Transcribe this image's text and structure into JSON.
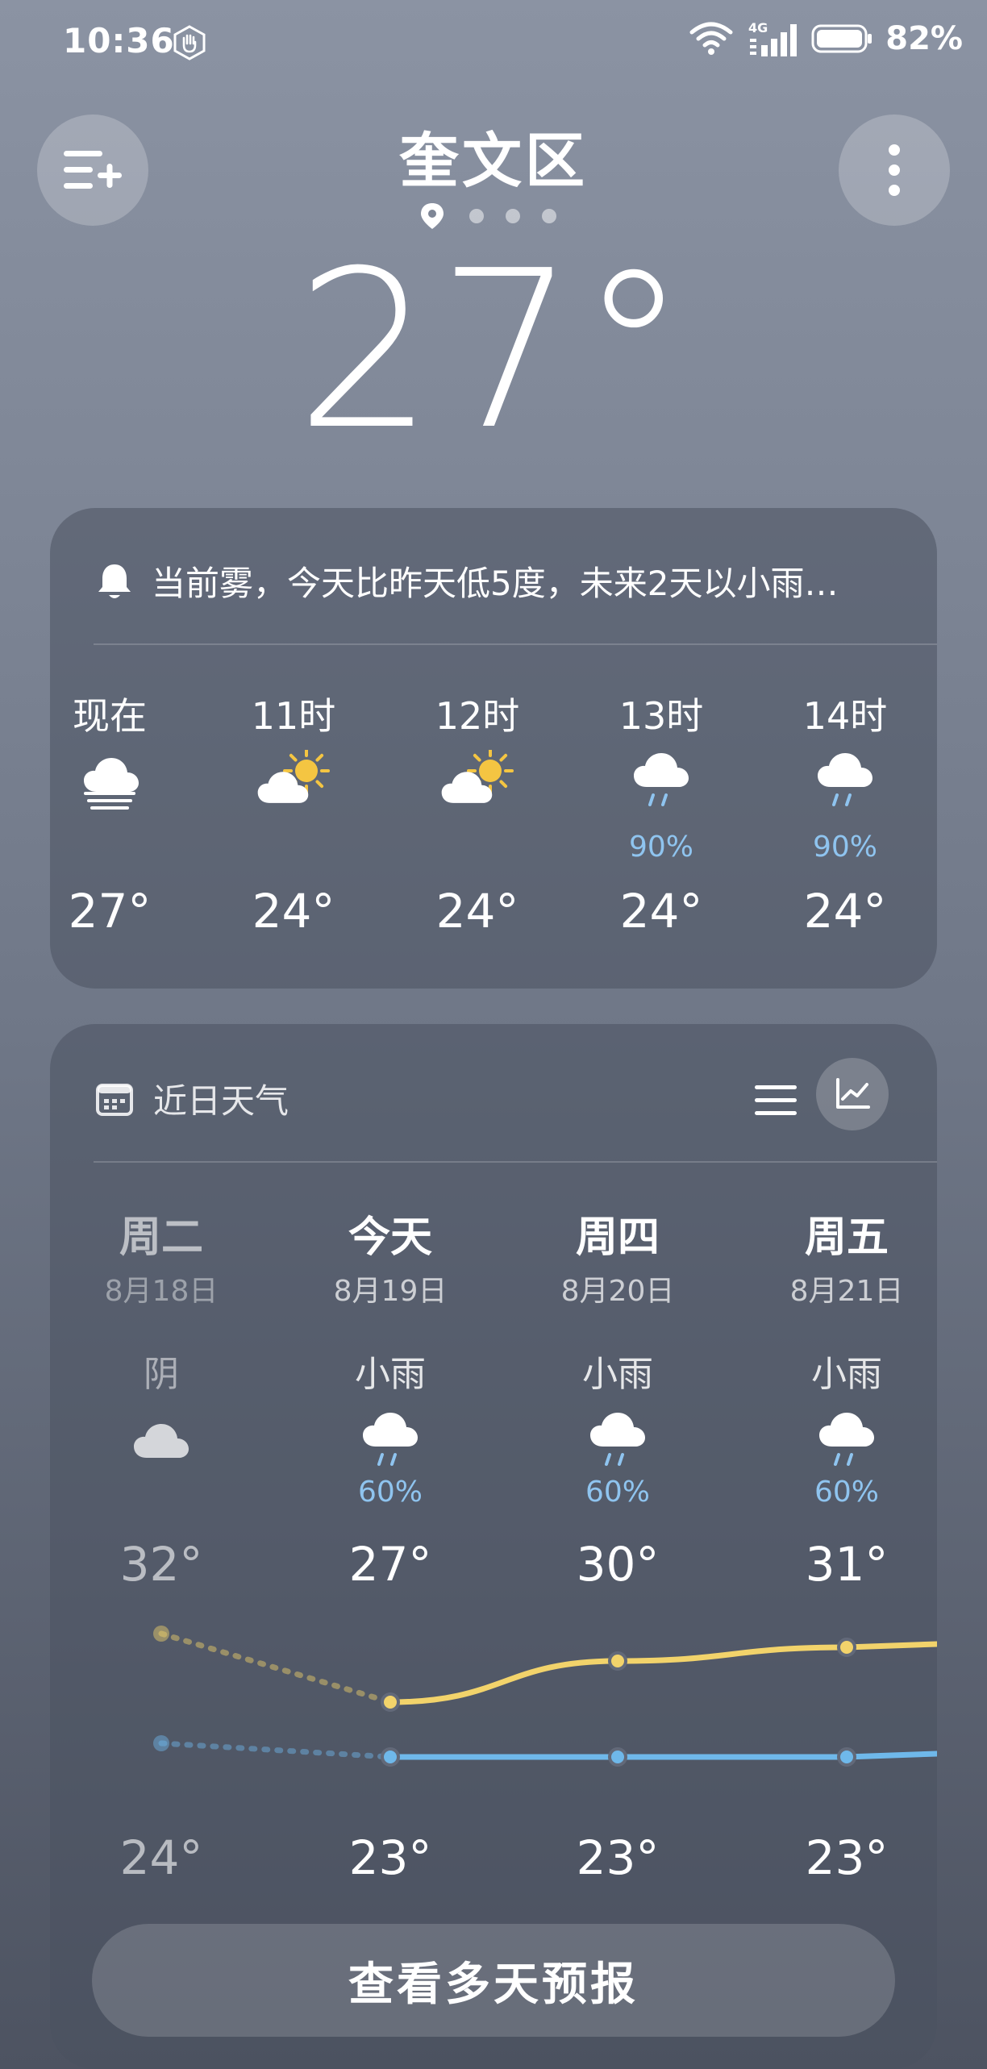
{
  "status_bar": {
    "time": "10:36",
    "network": "4G",
    "battery": "82%"
  },
  "location": {
    "city": "奎文区"
  },
  "current": {
    "temperature": "27°"
  },
  "alert": {
    "text": "当前雾，今天比昨天低5度，未来2天以小雨…"
  },
  "hourly": [
    {
      "label": "现在",
      "icon": "fog-icon",
      "temp": "27°",
      "prob": ""
    },
    {
      "label": "11时",
      "icon": "partly-cloudy-icon",
      "temp": "24°",
      "prob": ""
    },
    {
      "label": "12时",
      "icon": "partly-cloudy-icon",
      "temp": "24°",
      "prob": ""
    },
    {
      "label": "13时",
      "icon": "rain-icon",
      "temp": "24°",
      "prob": "90%"
    },
    {
      "label": "14时",
      "icon": "rain-icon",
      "temp": "24°",
      "prob": "90%"
    }
  ],
  "daily": {
    "title": "近日天气",
    "days": [
      {
        "name": "周二",
        "date": "8月18日",
        "condition": "阴",
        "icon": "cloudy-icon",
        "prob": "",
        "high": "32°",
        "low": "24°",
        "high_value": 32,
        "low_value": 24,
        "past": true
      },
      {
        "name": "今天",
        "date": "8月19日",
        "condition": "小雨",
        "icon": "rain-icon",
        "prob": "60%",
        "high": "27°",
        "low": "23°",
        "high_value": 27,
        "low_value": 23,
        "past": false
      },
      {
        "name": "周四",
        "date": "8月20日",
        "condition": "小雨",
        "icon": "rain-icon",
        "prob": "60%",
        "high": "30°",
        "low": "23°",
        "high_value": 30,
        "low_value": 23,
        "past": false
      },
      {
        "name": "周五",
        "date": "8月21日",
        "condition": "小雨",
        "icon": "rain-icon",
        "prob": "60%",
        "high": "31°",
        "low": "23°",
        "high_value": 31,
        "low_value": 23,
        "past": false
      }
    ],
    "forecast_button": "查看多天预报"
  },
  "colors": {
    "high_line": "#f2d36b",
    "low_line": "#6fb8ea",
    "rain_blue": "#8fc4ef",
    "sun": "#f4c542"
  }
}
